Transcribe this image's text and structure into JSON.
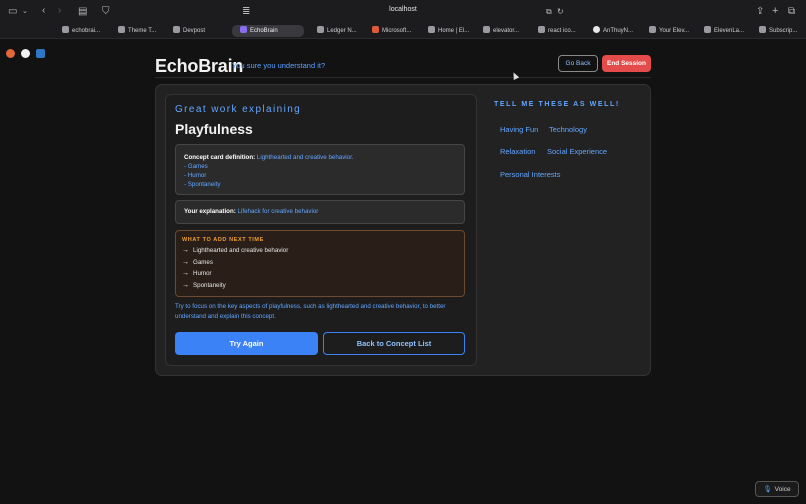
{
  "browser": {
    "url": "localhost",
    "tabs": [
      {
        "label": "echobrai...",
        "active": false
      },
      {
        "label": "Theme T...",
        "active": false
      },
      {
        "label": "Devpost",
        "active": false
      },
      {
        "label": "EchoBrain",
        "active": true
      },
      {
        "label": "Ledger N...",
        "active": false
      },
      {
        "label": "Microsoft...",
        "active": false
      },
      {
        "label": "Home | El...",
        "active": false
      },
      {
        "label": "elevator...",
        "active": false
      },
      {
        "label": "react ico...",
        "active": false
      },
      {
        "label": "AnThuyN...",
        "active": false
      },
      {
        "label": "Your Elev...",
        "active": false
      },
      {
        "label": "ElevenLa...",
        "active": false
      },
      {
        "label": "Subscrip...",
        "active": false
      }
    ]
  },
  "header": {
    "brand": "EchoBrain",
    "tagline": "You sure you understand it?",
    "go_back_label": "Go Back",
    "end_session_label": "End Session"
  },
  "result": {
    "heading": "Great work explaining",
    "concept_name": "Playfulness",
    "definition_label": "Concept card definition:",
    "definition_text": "Lighthearted and creative behavior.",
    "definition_items": [
      "- Games",
      "- Humor",
      "- Spontaneity"
    ],
    "explanation_label": "Your explanation:",
    "explanation_text": "Lifehack for creative behavior",
    "next_time_title": "WHAT TO ADD NEXT TIME",
    "next_time_items": [
      "Lighthearted and creative behavior",
      "Games",
      "Humor",
      "Spontaneity"
    ],
    "tip": "Try to focus on the key aspects of playfulness, such as lighthearted and creative behavior, to better understand and explain this concept.",
    "try_again_label": "Try Again",
    "back_to_list_label": "Back to Concept List"
  },
  "suggestions": {
    "title": "TELL ME THESE AS WELL!",
    "topics": [
      "Having Fun",
      "Technology",
      "Relaxation",
      "Social Experience",
      "Personal Interests"
    ]
  },
  "voice_label": "Voice",
  "colors": {
    "accent": "#3b82f6",
    "link": "#63a6ff",
    "danger": "#e44b4b",
    "warning": "#f0a030"
  }
}
